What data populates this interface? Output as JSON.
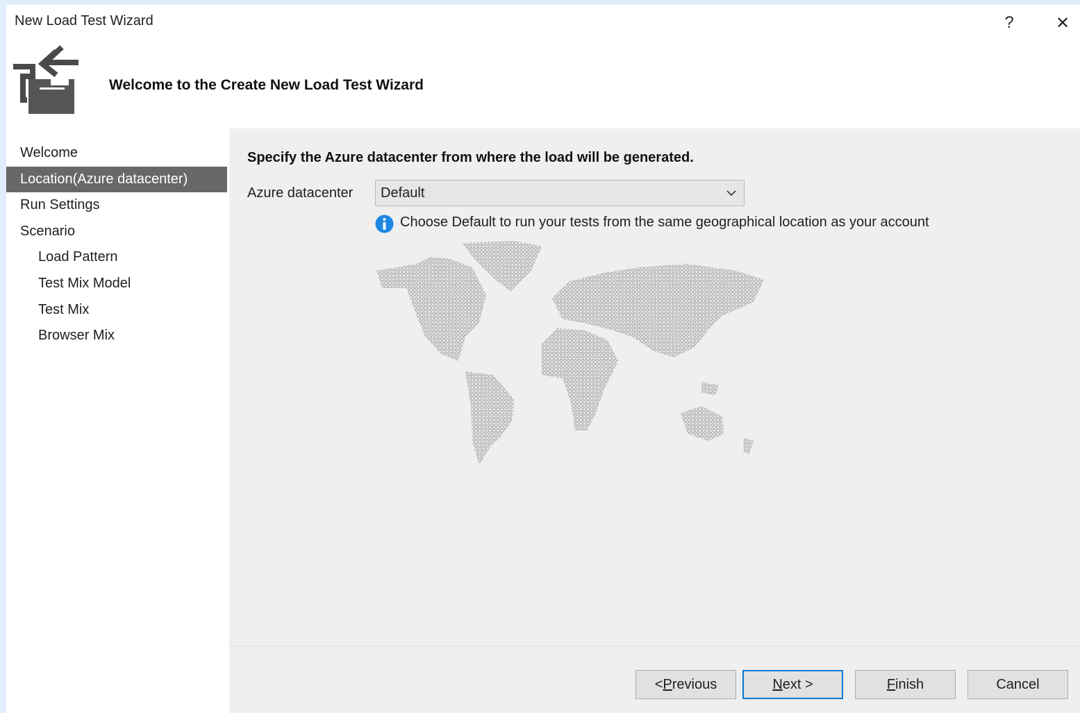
{
  "window": {
    "title": "New Load Test Wizard",
    "help_label": "?",
    "close_label": "✕"
  },
  "header": {
    "heading": "Welcome to the Create New Load Test Wizard",
    "icon": "wizard-icon"
  },
  "nav": {
    "items": [
      {
        "label": "Welcome",
        "level": 0,
        "active": false
      },
      {
        "label": "Location(Azure datacenter)",
        "level": 0,
        "active": true
      },
      {
        "label": "Run Settings",
        "level": 0,
        "active": false
      },
      {
        "label": "Scenario",
        "level": 0,
        "active": false
      },
      {
        "label": "Load Pattern",
        "level": 1,
        "active": false
      },
      {
        "label": "Test Mix Model",
        "level": 1,
        "active": false
      },
      {
        "label": "Test Mix",
        "level": 1,
        "active": false
      },
      {
        "label": "Browser Mix",
        "level": 1,
        "active": false
      }
    ]
  },
  "main": {
    "instruction": "Specify the Azure datacenter from where the load will be generated.",
    "datacenter_label": "Azure datacenter",
    "datacenter_value": "Default",
    "info_text": "Choose Default to run your tests from the same geographical location as your account",
    "map_icon": "world-map-dotted"
  },
  "footer": {
    "buttons": {
      "previous": {
        "pre": "< ",
        "mnemonic": "P",
        "post": "revious"
      },
      "next": {
        "pre": "",
        "mnemonic": "N",
        "post": "ext >"
      },
      "finish": {
        "pre": "",
        "mnemonic": "F",
        "post": "inish"
      },
      "cancel": {
        "pre": "",
        "mnemonic": "",
        "post": "Cancel"
      }
    }
  },
  "colors": {
    "nav_active_bg": "#686868",
    "content_bg": "#efefef",
    "primary_button_border": "#0078d7",
    "info_icon": "#1e88e5",
    "map_dots": "#9a9a9a"
  }
}
